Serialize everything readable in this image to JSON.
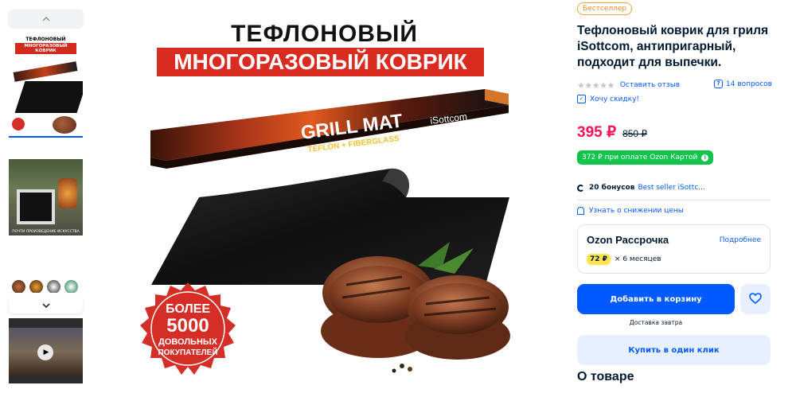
{
  "gallery": {
    "thumb1": {
      "title_line1": "ТЕФЛОНОВЫЙ",
      "title_line2": "МНОГОРАЗОВЫЙ КОВРИК"
    },
    "thumb2_caption": "ПОЧТИ ПРОИЗВЕДЕНИЕ ИСКУССТВА"
  },
  "hero": {
    "title_line1": "ТЕФЛОНОВЫЙ",
    "title_line2": "МНОГОРАЗОВЫЙ КОВРИК",
    "box_title": "GRILL MAT",
    "box_subtitle": "TEFLON + FIBERGLASS",
    "box_brand": "iSottcom",
    "seal_line1": "БОЛЕЕ",
    "seal_line2": "5000",
    "seal_line3": "ДОВОЛЬНЫХ",
    "seal_line4": "ПОКУПАТЕЛЕЙ"
  },
  "product": {
    "badge": "Бестселлер",
    "title": "Тефлоновый коврик для гриля iSottcom, антипригарный, подходит для выпечки.",
    "stars": "★★★★★",
    "leave_review": "Оставить отзыв",
    "questions": "14 вопросов",
    "want_discount": "Хочу скидку!",
    "price": "395 ₽",
    "old_price": "850 ₽",
    "ozon_card_price": "372 ₽ при оплате Ozon Картой",
    "bonus": "20 бонусов",
    "seller": "Best seller iSottc...",
    "price_alert": "Узнать о снижении цены",
    "installment": {
      "title": "Ozon Рассрочка",
      "more": "Подробнее",
      "price": "72 ₽",
      "term": "× 6 месяцев"
    },
    "add_to_cart": "Добавить в корзину",
    "delivery": "Доставка завтра",
    "buy_one_click": "Купить в один клик",
    "about": "О товаре"
  },
  "colors": {
    "accent": "#005bff",
    "price": "#f91155",
    "ozon_card": "#10c44c",
    "badge": "#f08a1e",
    "installment_highlight": "#ffe34f"
  }
}
